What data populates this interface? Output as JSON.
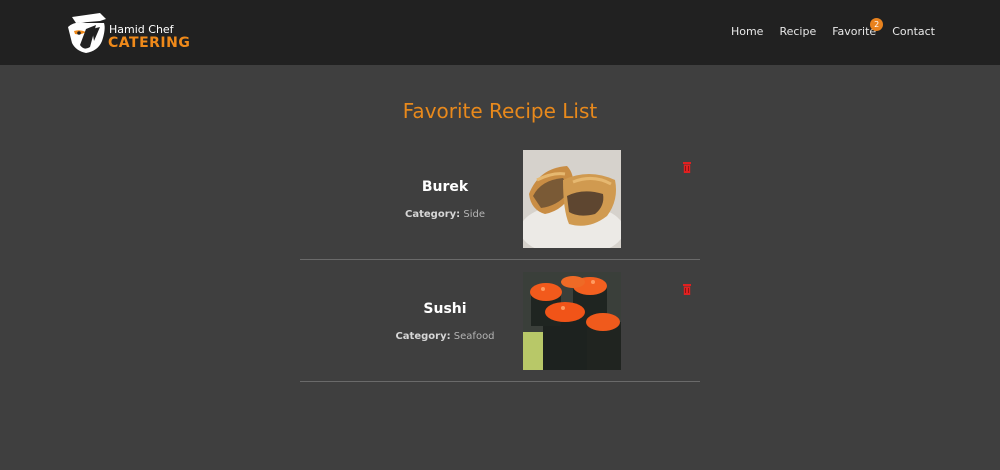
{
  "brand": {
    "line1": "Hamid Chef",
    "line2": "CATERING",
    "accent_color": "#f08a1a"
  },
  "nav": {
    "items": [
      "Home",
      "Recipe",
      "Favorite",
      "Contact"
    ],
    "favorite_count": "2"
  },
  "page": {
    "title": "Favorite Recipe List"
  },
  "favorites": [
    {
      "name": "Burek",
      "category_label": "Category:",
      "category": "Side",
      "image": "burek-photo"
    },
    {
      "name": "Sushi",
      "category_label": "Category:",
      "category": "Seafood",
      "image": "sushi-photo"
    }
  ],
  "icons": {
    "delete": "trash-icon"
  },
  "colors": {
    "header_bg": "#212121",
    "page_bg": "#3f3f3f",
    "title": "#e8891c",
    "badge": "#e8821e",
    "delete": "#e02020"
  }
}
